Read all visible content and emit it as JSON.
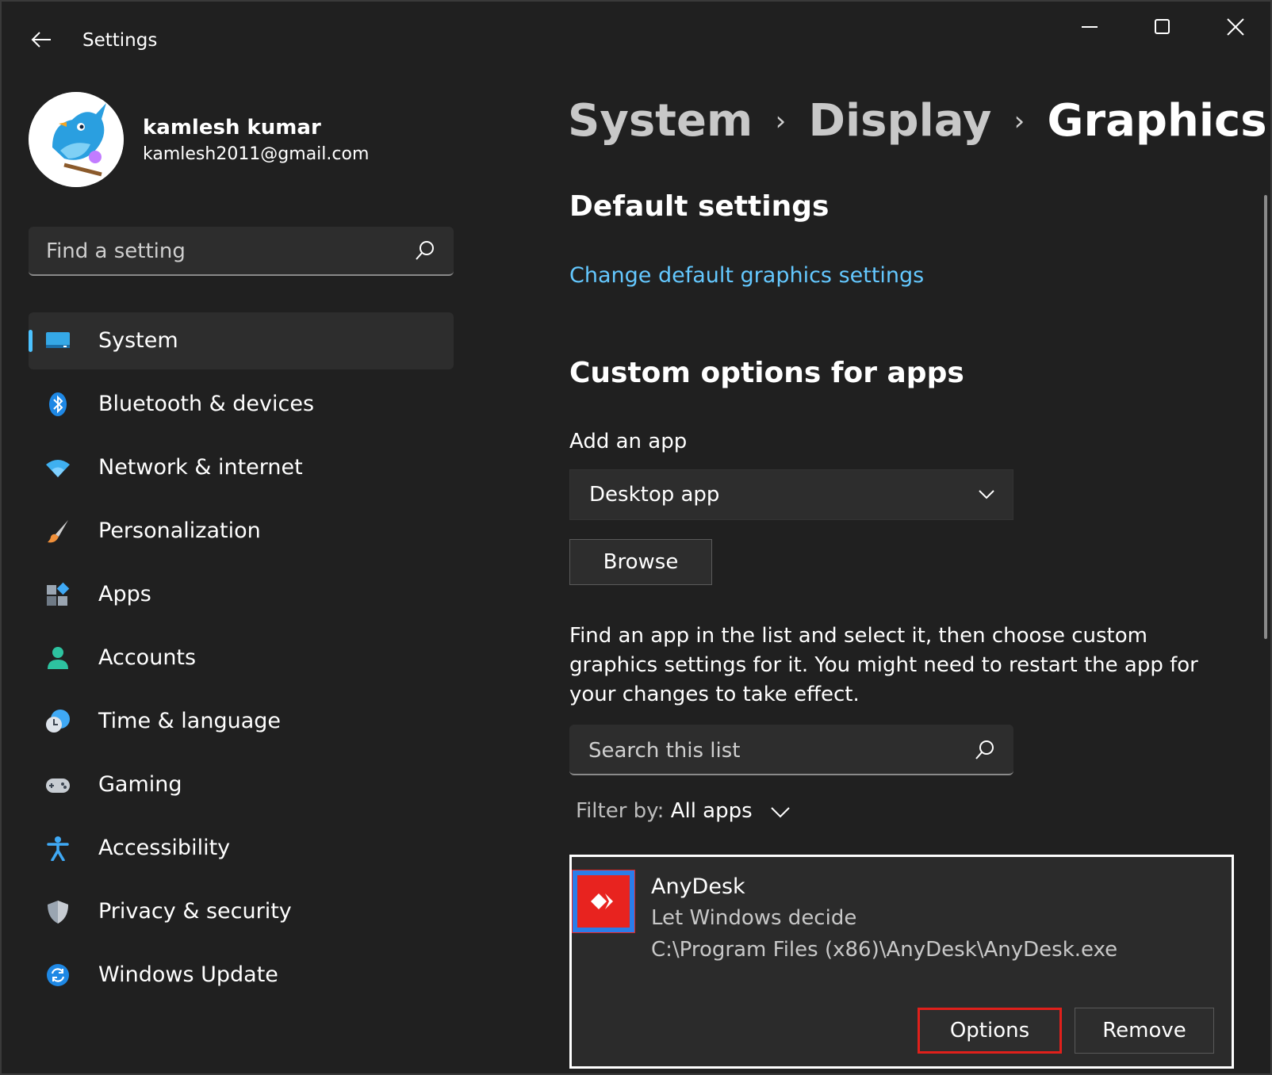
{
  "window": {
    "title": "Settings"
  },
  "profile": {
    "name": "kamlesh kumar",
    "email": "kamlesh2011@gmail.com"
  },
  "search": {
    "placeholder": "Find a setting"
  },
  "nav": {
    "items": [
      {
        "label": "System",
        "icon": "monitor-icon",
        "selected": true
      },
      {
        "label": "Bluetooth & devices",
        "icon": "bluetooth-icon"
      },
      {
        "label": "Network & internet",
        "icon": "wifi-icon"
      },
      {
        "label": "Personalization",
        "icon": "brush-icon"
      },
      {
        "label": "Apps",
        "icon": "apps-icon"
      },
      {
        "label": "Accounts",
        "icon": "person-icon"
      },
      {
        "label": "Time & language",
        "icon": "clock-globe-icon"
      },
      {
        "label": "Gaming",
        "icon": "gamepad-icon"
      },
      {
        "label": "Accessibility",
        "icon": "accessibility-icon"
      },
      {
        "label": "Privacy & security",
        "icon": "shield-icon"
      },
      {
        "label": "Windows Update",
        "icon": "update-icon"
      }
    ]
  },
  "breadcrumb": {
    "items": [
      "System",
      "Display",
      "Graphics"
    ],
    "separator": "›"
  },
  "main": {
    "default_heading": "Default settings",
    "default_link": "Change default graphics settings",
    "custom_heading": "Custom options for apps",
    "add_app_label": "Add an app",
    "app_type_selected": "Desktop app",
    "browse_label": "Browse",
    "description": "Find an app in the list and select it, then choose custom graphics settings for it. You might need to restart the app for your changes to take effect.",
    "list_search_placeholder": "Search this list",
    "filter_label": "Filter by:",
    "filter_value": "All apps"
  },
  "app_entry": {
    "name": "AnyDesk",
    "preference": "Let Windows decide",
    "path": "C:\\Program Files (x86)\\AnyDesk\\AnyDesk.exe",
    "options_label": "Options",
    "remove_label": "Remove"
  },
  "colors": {
    "accent": "#4cc2ff",
    "link": "#64c8ff",
    "highlight_border": "#e0201b",
    "anydesk_red": "#e8231f"
  }
}
